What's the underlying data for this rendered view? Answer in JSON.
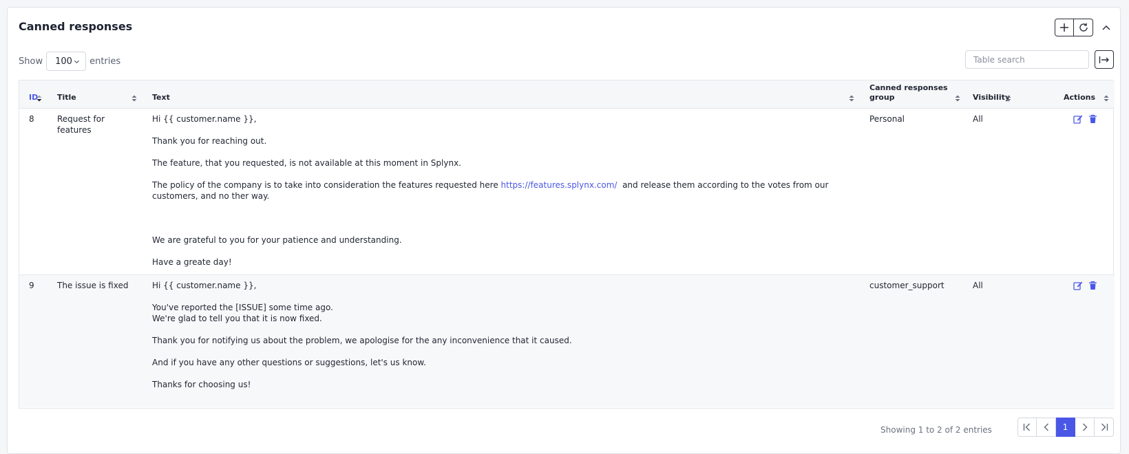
{
  "card": {
    "title": "Canned responses",
    "tools": [
      "plus-icon",
      "refresh-icon"
    ],
    "collapse_icon": "chevron-up-icon"
  },
  "length": {
    "show_label": "Show",
    "value": "100",
    "entries_label": "entries"
  },
  "search": {
    "placeholder": "Table search"
  },
  "table": {
    "columns": [
      "ID",
      "Title",
      "Text",
      "Canned responses group",
      "Visibility",
      "Actions"
    ],
    "rows": [
      {
        "id": "8",
        "title": "Request for features",
        "text": {
          "greeting": "Hi {{ customer.name }},",
          "p1": "Thank you for reaching out.",
          "p2": "The feature, that you requested, is not available at this moment in Splynx.",
          "p3_before": "The policy of the company is to take into consideration the features requested here ",
          "p3_link": "https://features.splynx.com/",
          "p3_after": "  and release them according to the votes from our customers, and no ther way.",
          "p4": "We are grateful to you for your patience and understanding.",
          "p5": "Have a greate day!"
        },
        "group": "Personal",
        "visibility": "All"
      },
      {
        "id": "9",
        "title": "The issue is fixed",
        "text": {
          "greeting": "Hi {{ customer.name }},",
          "p1_line1": "You've reported the [ISSUE] some time ago.",
          "p1_line2": "We're glad to tell you that it is now fixed.",
          "p2": "Thank you for notifying us about the problem, we apologise for the any inconvenience that it caused.",
          "p3": "And if you have any other questions or suggestions, let's us know.",
          "p4": "Thanks for choosing us!"
        },
        "group": "customer_support",
        "visibility": "All"
      }
    ]
  },
  "footer": {
    "info": "Showing 1 to 2 of 2 entries",
    "current_page": "1"
  },
  "colors": {
    "accent": "#4a57e6"
  }
}
